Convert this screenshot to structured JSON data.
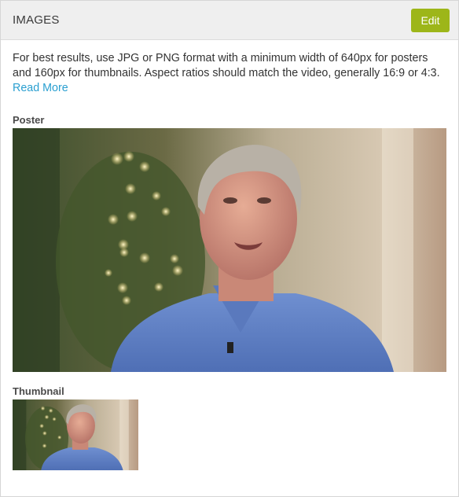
{
  "panel": {
    "title": "IMAGES",
    "edit_label": "Edit",
    "accent_color": "#9db619"
  },
  "help": {
    "text": "For best results, use JPG or PNG format with a minimum width of 640px for posters and 160px for thumbnails. Aspect ratios should match the video, generally 16:9 or 4:3.",
    "link_label": "Read More",
    "link_color": "#2a9fd0"
  },
  "poster": {
    "label": "Poster"
  },
  "thumbnail": {
    "label": "Thumbnail"
  }
}
